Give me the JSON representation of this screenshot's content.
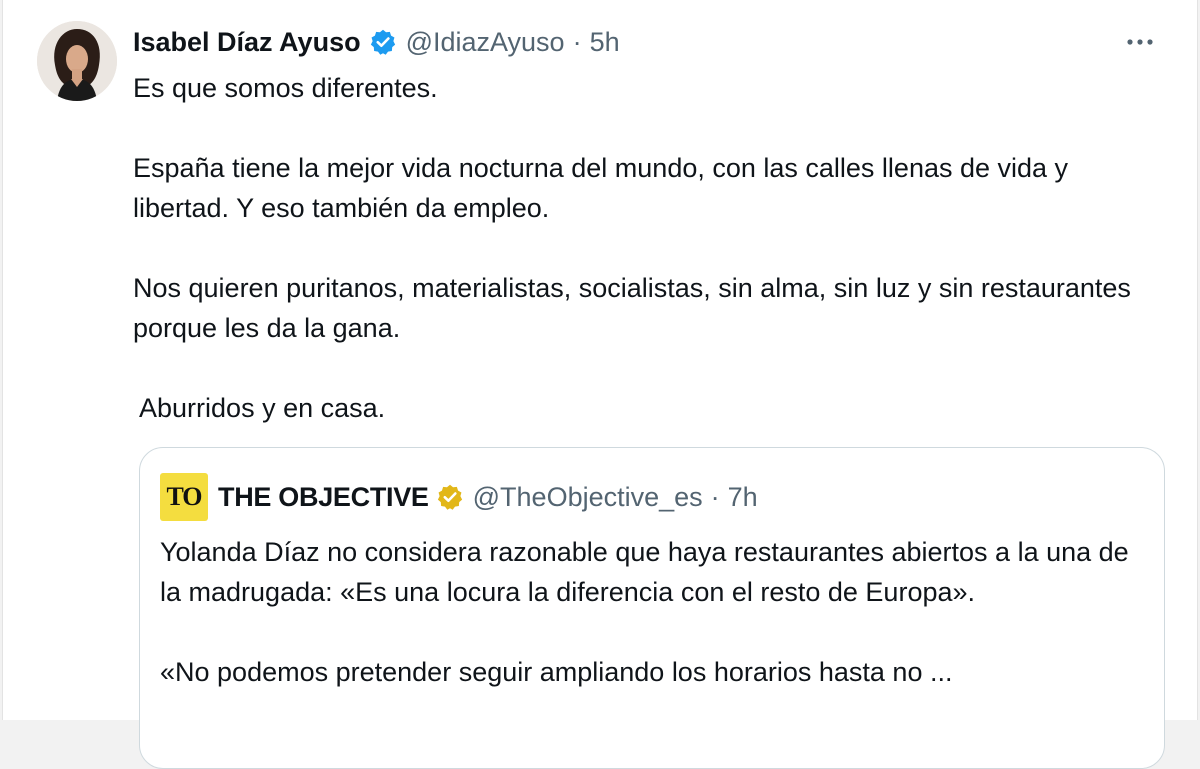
{
  "tweet": {
    "author_name": "Isabel Díaz Ayuso",
    "author_handle": "@IdiazAyuso",
    "time_separator": "·",
    "time": "5h",
    "paragraphs": [
      "Es que somos diferentes.",
      "España tiene la mejor vida nocturna del mundo, con las calles llenas de vida y libertad. Y eso también da empleo.",
      "Nos quieren puritanos, materialistas, socialistas, sin alma, sin luz y sin restaurantes porque les da la gana.",
      " Aburridos y en casa."
    ],
    "verified_badge_color": "#1d9bf0",
    "more_icon": "more-horizontal-icon"
  },
  "quoted": {
    "logo_text": "TO",
    "logo_color": "#f4dd3f",
    "author_name": "THE OBJECTIVE",
    "author_handle": "@TheObjective_es",
    "time_separator": "·",
    "time": "7h",
    "badge_color": "#e2b719",
    "paragraphs": [
      "Yolanda Díaz no considera razonable que haya restaurantes abiertos a la una de la madrugada: «Es una locura la diferencia con el resto de Europa».",
      "«No podemos pretender seguir ampliando los horarios hasta no ..."
    ]
  }
}
